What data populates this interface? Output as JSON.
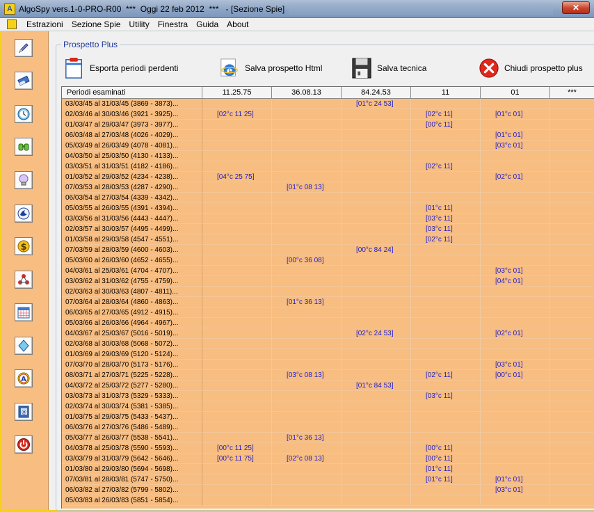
{
  "window": {
    "title": "AlgoSpy vers.1-0-PRO-R00  ***  Oggi 22 feb 2012  ***   - [Sezione Spie]"
  },
  "menu": [
    "Estrazioni",
    "Sezione Spie",
    "Utility",
    "Finestra",
    "Guida",
    "About"
  ],
  "sidebar": {
    "buttons": [
      "pencil-icon",
      "eraser-icon",
      "clock-icon",
      "binoculars-icon",
      "lightbulb-icon",
      "lottery-icon",
      "dollar-icon",
      "network-icon",
      "calendar-icon",
      "drop-icon",
      "a-icon",
      "book-icon",
      "power-icon"
    ]
  },
  "panel": {
    "title": "Prospetto Plus",
    "toolbar": [
      {
        "label": "Esporta periodi perdenti",
        "icon": "clipboard-icon"
      },
      {
        "label": "Salva prospetto Html",
        "icon": "ie-icon"
      },
      {
        "label": "Salva tecnica",
        "icon": "floppy-icon"
      },
      {
        "label": "Chiudi prospetto plus",
        "icon": "close-icon"
      }
    ]
  },
  "table": {
    "columns": [
      "Periodi esaminati",
      "11.25.75",
      "36.08.13",
      "84.24.53",
      "11",
      "01",
      "***"
    ],
    "rows": [
      [
        "03/03/45 al 31/03/45  (3869 - 3873)...",
        "",
        "",
        "[01°c 24 53]",
        "",
        "",
        ""
      ],
      [
        "02/03/46 al 30/03/46  (3921 - 3925)...",
        "[02°c 11 25]",
        "",
        "",
        "[02°c 11]",
        "[01°c 01]",
        ""
      ],
      [
        "01/03/47 al 29/03/47  (3973 - 3977)...",
        "",
        "",
        "",
        "[00°c 11]",
        "",
        ""
      ],
      [
        "06/03/48 al 27/03/48  (4026 - 4029)...",
        "",
        "",
        "",
        "",
        "[01°c 01]",
        ""
      ],
      [
        "05/03/49 al 26/03/49  (4078 - 4081)...",
        "",
        "",
        "",
        "",
        "[03°c 01]",
        ""
      ],
      [
        "04/03/50 al 25/03/50  (4130 - 4133)...",
        "",
        "",
        "",
        "",
        "",
        ""
      ],
      [
        "03/03/51 al 31/03/51  (4182 - 4186)...",
        "",
        "",
        "",
        "[02°c 11]",
        "",
        ""
      ],
      [
        "01/03/52 al 29/03/52  (4234 - 4238)...",
        "[04°c 25 75]",
        "",
        "",
        "",
        "[02°c 01]",
        ""
      ],
      [
        "07/03/53 al 28/03/53  (4287 - 4290)...",
        "",
        "[01°c 08 13]",
        "",
        "",
        "",
        ""
      ],
      [
        "06/03/54 al 27/03/54  (4339 - 4342)...",
        "",
        "",
        "",
        "",
        "",
        ""
      ],
      [
        "05/03/55 al 26/03/55  (4391 - 4394)...",
        "",
        "",
        "",
        "[01°c 11]",
        "",
        ""
      ],
      [
        "03/03/56 al 31/03/56  (4443 - 4447)...",
        "",
        "",
        "",
        "[03°c 11]",
        "",
        ""
      ],
      [
        "02/03/57 al 30/03/57  (4495 - 4499)...",
        "",
        "",
        "",
        "[03°c 11]",
        "",
        ""
      ],
      [
        "01/03/58 al 29/03/58  (4547 - 4551)...",
        "",
        "",
        "",
        "[02°c 11]",
        "",
        ""
      ],
      [
        "07/03/59 al 28/03/59  (4600 - 4603)...",
        "",
        "",
        "[00°c 84 24]",
        "",
        "",
        ""
      ],
      [
        "05/03/60 al 26/03/60  (4652 - 4655)...",
        "",
        "[00°c 36 08]",
        "",
        "",
        "",
        ""
      ],
      [
        "04/03/61 al 25/03/61  (4704 - 4707)...",
        "",
        "",
        "",
        "",
        "[03°c 01]",
        ""
      ],
      [
        "03/03/62 al 31/03/62  (4755 - 4759)...",
        "",
        "",
        "",
        "",
        "[04°c 01]",
        ""
      ],
      [
        "02/03/63 al 30/03/63  (4807 - 4811)...",
        "",
        "",
        "",
        "",
        "",
        ""
      ],
      [
        "07/03/64 al 28/03/64  (4860 - 4863)...",
        "",
        "[01°c 36 13]",
        "",
        "",
        "",
        ""
      ],
      [
        "06/03/65 al 27/03/65  (4912 - 4915)...",
        "",
        "",
        "",
        "",
        "",
        ""
      ],
      [
        "05/03/66 al 26/03/66  (4964 - 4967)...",
        "",
        "",
        "",
        "",
        "",
        ""
      ],
      [
        "04/03/67 al 25/03/67  (5016 - 5019)...",
        "",
        "",
        "[02°c 24 53]",
        "",
        "[02°c 01]",
        ""
      ],
      [
        "02/03/68 al 30/03/68  (5068 - 5072)...",
        "",
        "",
        "",
        "",
        "",
        ""
      ],
      [
        "01/03/69 al 29/03/69  (5120 - 5124)...",
        "",
        "",
        "",
        "",
        "",
        ""
      ],
      [
        "07/03/70 al 28/03/70  (5173 - 5176)...",
        "",
        "",
        "",
        "",
        "[03°c 01]",
        ""
      ],
      [
        "08/03/71 al 27/03/71  (5225 - 5228)...",
        "",
        "[03°c 08 13]",
        "",
        "[02°c 11]",
        "[00°c 01]",
        ""
      ],
      [
        "04/03/72 al 25/03/72  (5277 - 5280)...",
        "",
        "",
        "[01°c 84 53]",
        "",
        "",
        ""
      ],
      [
        "03/03/73 al 31/03/73  (5329 - 5333)...",
        "",
        "",
        "",
        "[03°c 11]",
        "",
        ""
      ],
      [
        "02/03/74 al 30/03/74  (5381 - 5385)...",
        "",
        "",
        "",
        "",
        "",
        ""
      ],
      [
        "01/03/75 al 29/03/75  (5433 - 5437)...",
        "",
        "",
        "",
        "",
        "",
        ""
      ],
      [
        "06/03/76 al 27/03/76  (5486 - 5489)...",
        "",
        "",
        "",
        "",
        "",
        ""
      ],
      [
        "05/03/77 al 26/03/77  (5538 - 5541)...",
        "",
        "[01°c 36 13]",
        "",
        "",
        "",
        ""
      ],
      [
        "04/03/78 al 25/03/78  (5590 - 5593)...",
        "[00°c 11 25]",
        "",
        "",
        "[00°c 11]",
        "",
        ""
      ],
      [
        "03/03/79 al 31/03/79  (5642 - 5646)...",
        "[00°c 11 75]",
        "[02°c 08 13]",
        "",
        "[00°c 11]",
        "",
        ""
      ],
      [
        "01/03/80 al 29/03/80  (5694 - 5698)...",
        "",
        "",
        "",
        "[01°c 11]",
        "",
        ""
      ],
      [
        "07/03/81 al 28/03/81  (5747 - 5750)...",
        "",
        "",
        "",
        "[01°c 11]",
        "[01°c 01]",
        ""
      ],
      [
        "06/03/82 al 27/03/82  (5799 - 5802)...",
        "",
        "",
        "",
        "",
        "[03°c 01]",
        ""
      ],
      [
        "05/03/83 al 26/03/83  (5851 - 5854)...",
        "",
        "",
        "",
        "",
        "",
        ""
      ]
    ]
  },
  "colors": {
    "sidebar_bg": "#f7bd81",
    "table_bg": "#f7bd81",
    "cell_text": "#1d1dcc",
    "frame_accent": "#f4d21b"
  }
}
